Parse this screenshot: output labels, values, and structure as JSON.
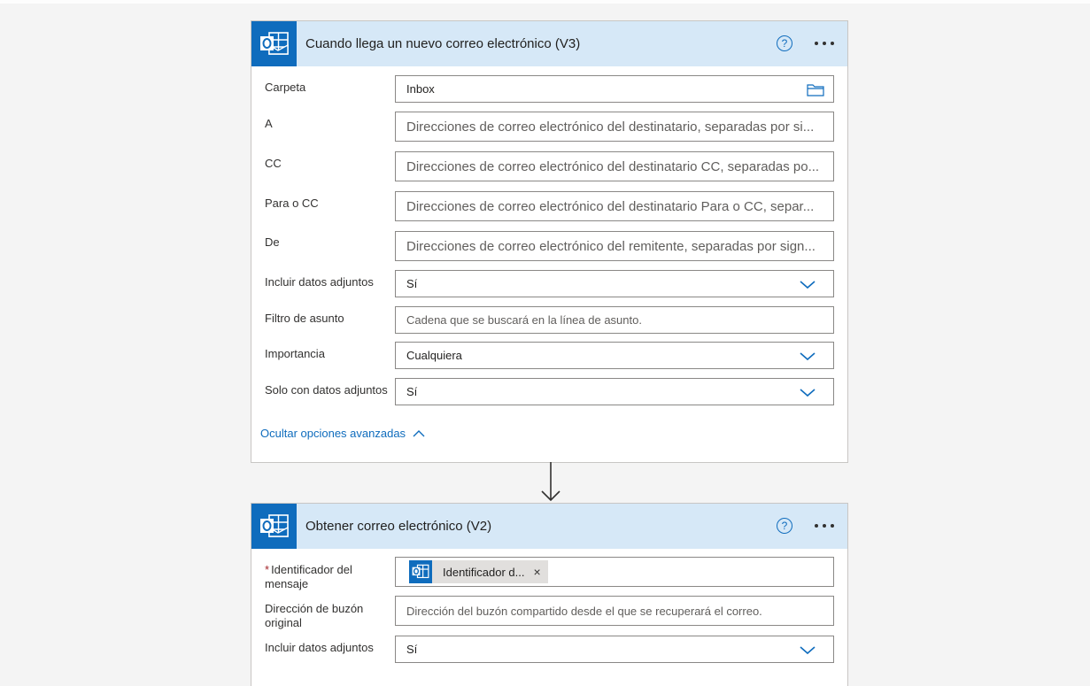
{
  "trigger": {
    "title": "Cuando llega un nuevo correo electrónico (V3)",
    "help_glyph": "?",
    "fields": {
      "folder": {
        "label": "Carpeta",
        "value": "Inbox",
        "icon": "folder-icon"
      },
      "to": {
        "label": "A",
        "placeholder": "Direcciones de correo electrónico del destinatario, separadas por si..."
      },
      "cc": {
        "label": "CC",
        "placeholder": "Direcciones de correo electrónico del destinatario CC, separadas po..."
      },
      "to_or_cc": {
        "label": "Para o CC",
        "placeholder": "Direcciones de correo electrónico del destinatario Para o CC, separ..."
      },
      "from": {
        "label": "De",
        "placeholder": "Direcciones de correo electrónico del remitente, separadas por sign..."
      },
      "include_attachments": {
        "label": "Incluir datos adjuntos",
        "value": "Sí"
      },
      "subject_filter": {
        "label": "Filtro de asunto",
        "placeholder": "Cadena que se buscará en la línea de asunto."
      },
      "importance": {
        "label": "Importancia",
        "value": "Cualquiera"
      },
      "only_with_attachments": {
        "label": "Solo con datos adjuntos",
        "value": "Sí"
      }
    },
    "advanced_link": "Ocultar opciones avanzadas"
  },
  "action": {
    "title": "Obtener correo electrónico (V2)",
    "help_glyph": "?",
    "fields": {
      "message_id": {
        "required_mark": "*",
        "label_line1": "Identificador del",
        "label_line2": "mensaje",
        "token_text": "Identificador d...",
        "token_remove": "×"
      },
      "mailbox": {
        "label_line1": "Dirección de buzón",
        "label_line2": "original",
        "placeholder": "Dirección del buzón compartido desde el que se recuperará el correo."
      },
      "include_attachments": {
        "label": "Incluir datos adjuntos",
        "value": "Sí"
      }
    }
  },
  "colors": {
    "accent": "#0f6cbd",
    "header_bg": "#d6e8f7",
    "border": "#8a8886"
  }
}
